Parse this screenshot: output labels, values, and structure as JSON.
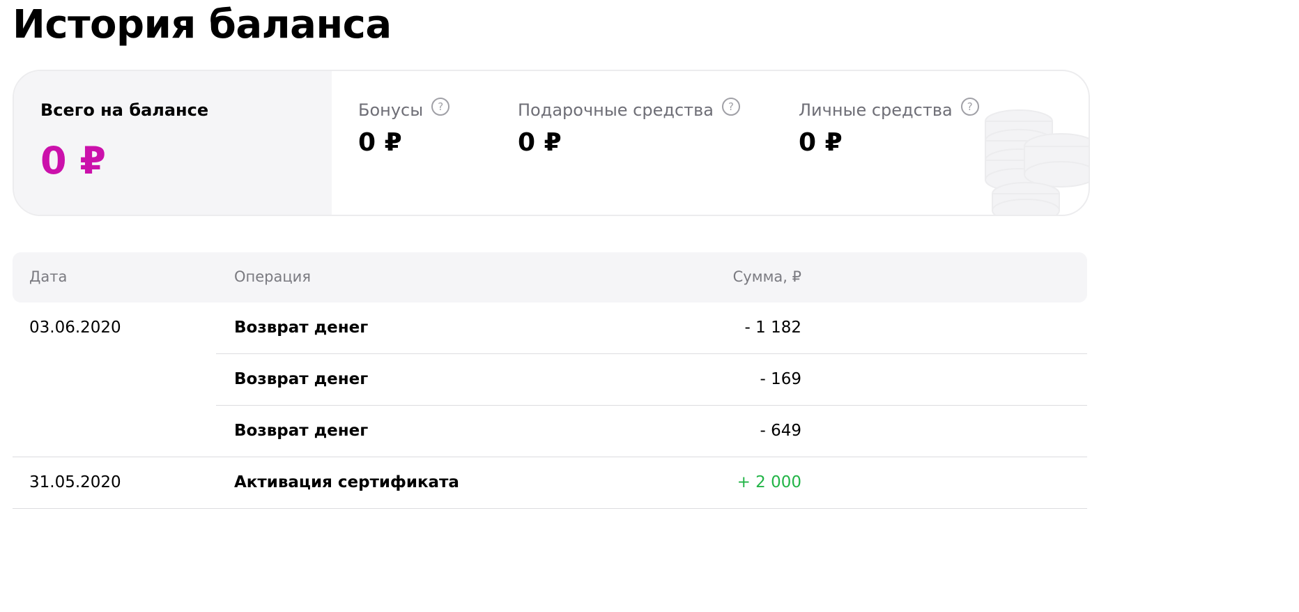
{
  "page": {
    "title": "История баланса"
  },
  "balance": {
    "total_label": "Всего на балансе",
    "total_amount": "0 ₽",
    "parts": [
      {
        "label": "Бонусы",
        "amount": "0 ₽",
        "help_glyph": "?"
      },
      {
        "label": "Подарочные средства",
        "amount": "0 ₽",
        "help_glyph": "?"
      },
      {
        "label": "Личные средства",
        "amount": "0 ₽",
        "help_glyph": "?"
      }
    ],
    "accent_color": "#cb11ab",
    "illustration_icon": "coins-stack-icon"
  },
  "table": {
    "headers": {
      "date": "Дата",
      "operation": "Операция",
      "amount": "Сумма, ₽"
    },
    "rows": [
      {
        "date": "03.06.2020",
        "operation": "Возврат денег",
        "amount": "- 1 182",
        "positive": false
      },
      {
        "date": "",
        "operation": "Возврат денег",
        "amount": "- 169",
        "positive": false
      },
      {
        "date": "",
        "operation": "Возврат денег",
        "amount": "- 649",
        "positive": false
      },
      {
        "date": "31.05.2020",
        "operation": "Активация сертификата",
        "amount": "+ 2 000",
        "positive": true
      }
    ],
    "positive_color": "#22b447"
  }
}
